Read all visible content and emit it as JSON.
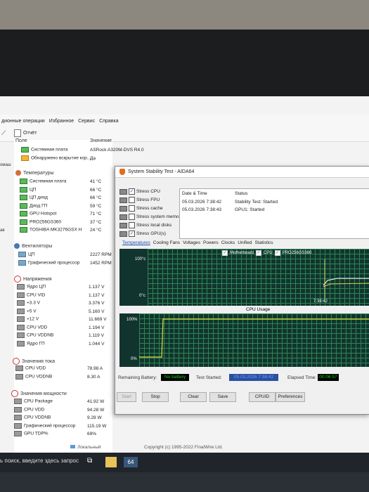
{
  "menu": {
    "items": [
      "дионные операции",
      "Избранное",
      "Сервис",
      "Справка"
    ]
  },
  "toolbar": {
    "report_label": "Отчёт"
  },
  "left_strip": {
    "label1": "омаш",
    "label2": "ав"
  },
  "columns": {
    "field": "Поле",
    "value": "Значение"
  },
  "tree": {
    "top_rows": [
      {
        "label": "Системная плата",
        "value": "ASRock A320M-DVS R4.0"
      },
      {
        "label": "Обнаружено вскрытие кор...",
        "value": "Да"
      }
    ],
    "temps_header": "Температуры",
    "temps": [
      {
        "label": "Системная плата",
        "value": "41 °C"
      },
      {
        "label": "ЦП",
        "value": "66 °C"
      },
      {
        "label": "ЦП диод",
        "value": "66 °C"
      },
      {
        "label": "Диод ГП",
        "value": "59 °C"
      },
      {
        "label": "GPU Hotspot",
        "value": "71 °C"
      },
      {
        "label": "PRO256GS360",
        "value": "37 °C"
      },
      {
        "label": "TOSHIBA MK3276GSX H",
        "value": "24 °C"
      }
    ],
    "fans_header": "Вентиляторы",
    "fans": [
      {
        "label": "ЦП",
        "value": "2227 RPM"
      },
      {
        "label": "Графический процессор",
        "value": "1452 RPM"
      }
    ],
    "volts_header": "Напряжения",
    "volts": [
      {
        "label": "Ядро ЦП",
        "value": "1.137 V"
      },
      {
        "label": "CPU VID",
        "value": "1.137 V"
      },
      {
        "label": "+3.3 V",
        "value": "3.376 V"
      },
      {
        "label": "+5 V",
        "value": "5.160 V"
      },
      {
        "label": "+12 V",
        "value": "11.669 V"
      },
      {
        "label": "CPU VDD",
        "value": "1.194 V"
      },
      {
        "label": "CPU VDDNB",
        "value": "1.119 V"
      },
      {
        "label": "Ядро ГП",
        "value": "1.044 V"
      }
    ],
    "current_header": "Значения тока",
    "current": [
      {
        "label": "CPU VDD",
        "value": "78.98 A"
      },
      {
        "label": "CPU VDDNB",
        "value": "8.30 A"
      }
    ],
    "power_header": "Значения мощности",
    "power": [
      {
        "label": "CPU Package",
        "value": "41.92 W"
      },
      {
        "label": "CPU VDD",
        "value": "94.28 W"
      },
      {
        "label": "CPU VDDNB",
        "value": "9.28 W"
      },
      {
        "label": "Графический процессор",
        "value": "115.19 W"
      },
      {
        "label": "GPU TDP%",
        "value": "69%"
      }
    ]
  },
  "statusbar": {
    "local": "Локальный",
    "copyright": "Copyright (c) 1995-2022 FinalWire Ltd."
  },
  "taskbar": {
    "search": "ь поиск, введите здесь запрос",
    "app": "64"
  },
  "stability": {
    "title": "System Stability Test - AIDA64",
    "options": [
      {
        "label": "Stress CPU",
        "checked": true
      },
      {
        "label": "Stress FPU",
        "checked": false
      },
      {
        "label": "Stress cache",
        "checked": false
      },
      {
        "label": "Stress system memory",
        "checked": false
      },
      {
        "label": "Stress local disks",
        "checked": false
      },
      {
        "label": "Stress GPU(s)",
        "checked": true
      }
    ],
    "log_headers": {
      "date": "Date & Time",
      "status": "Status"
    },
    "log": [
      {
        "date": "05.03.2026 7:38:42",
        "status": "Stability Test: Started"
      },
      {
        "date": "05.03.2026 7:38:43",
        "status": "GPU1: Started"
      }
    ],
    "tabs": [
      "Temperatures",
      "Cooling Fans",
      "Voltages",
      "Powers",
      "Clocks",
      "Unified",
      "Statistics"
    ],
    "temp_graph": {
      "top": "100°c",
      "bottom": "0°c",
      "time": "7:38:42",
      "legend": [
        "Motherboard",
        "CPU",
        "PRO256GS360"
      ]
    },
    "cpu_graph": {
      "title": "CPU Usage",
      "top": "100%",
      "bottom": "0%"
    },
    "remaining_battery_label": "Remaining Battery:",
    "remaining_battery_value": "No battery",
    "test_started_label": "Test Started:",
    "test_started_value": "05.03.2026 7:38:42",
    "elapsed_label": "Elapsed Time:",
    "elapsed_value": "00:06:57",
    "buttons": {
      "start": "Start",
      "stop": "Stop",
      "clear": "Clear",
      "save": "Save",
      "cpuid": "CPUID",
      "prefs": "Preferences"
    },
    "colors": {
      "graph_bg": "#12342e",
      "grid": "#2f8f5a",
      "usage_line": "#e0e03a",
      "temp_line": "#ffffff"
    }
  }
}
